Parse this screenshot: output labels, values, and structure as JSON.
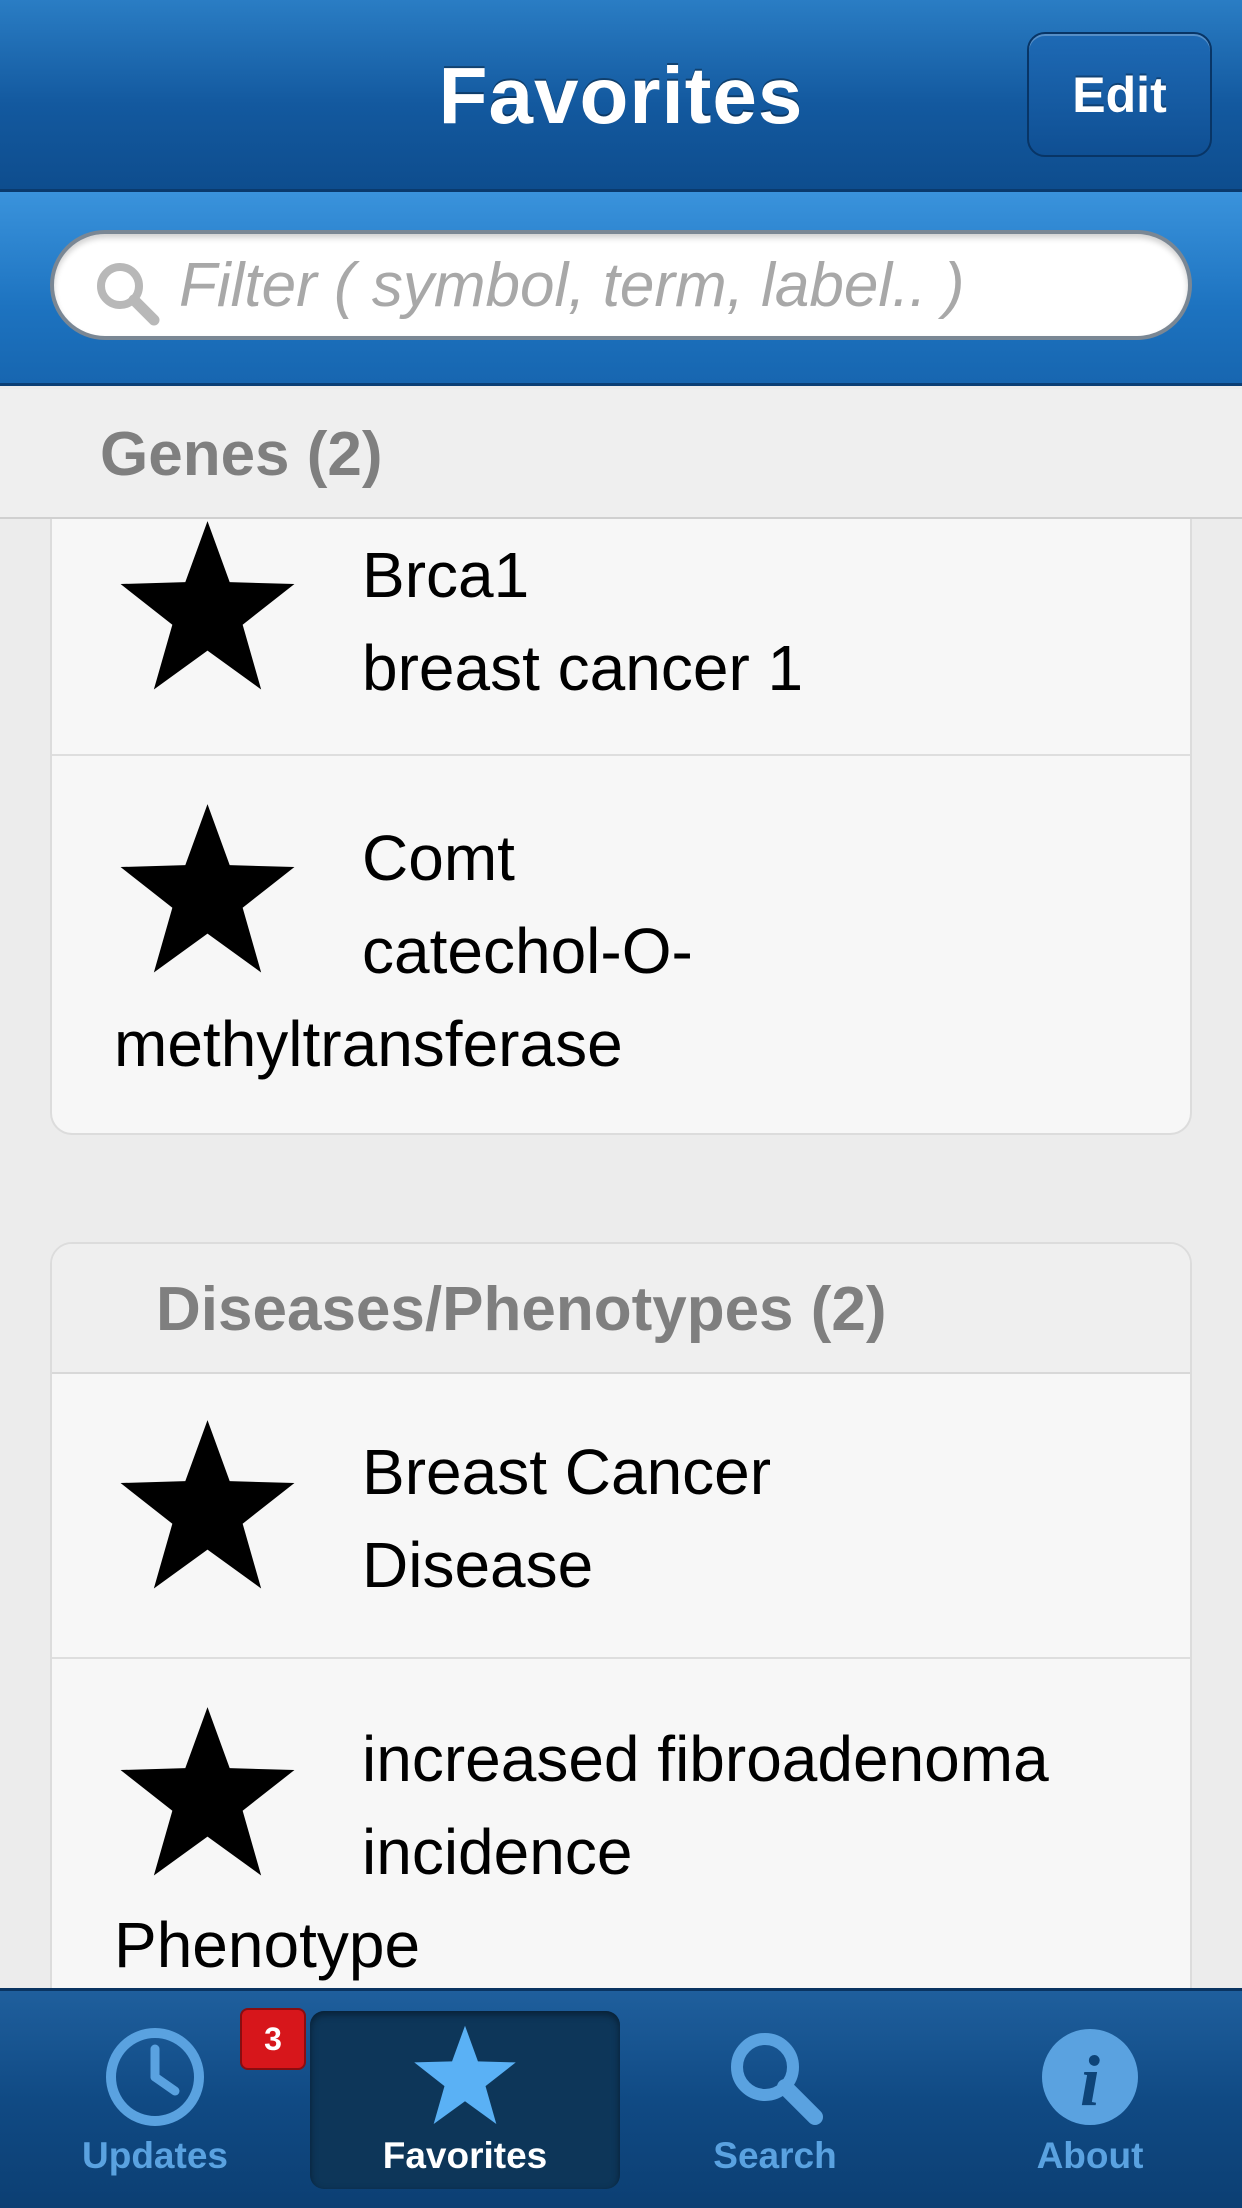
{
  "header": {
    "title": "Favorites",
    "edit_label": "Edit"
  },
  "filter": {
    "placeholder": "Filter ( symbol, term, label.. )"
  },
  "sections": [
    {
      "title": "Genes (2)",
      "items": [
        {
          "line1": "Brca1",
          "line2": "breast cancer 1",
          "line3": ""
        },
        {
          "line1": "Comt",
          "line2": "catechol-O-",
          "line3": "methyltransferase"
        }
      ]
    },
    {
      "title": "Diseases/Phenotypes (2)",
      "items": [
        {
          "line1": "Breast Cancer",
          "line2": "Disease",
          "line3": ""
        },
        {
          "line1": "increased fibroadenoma",
          "line2": "incidence",
          "line3": "Phenotype"
        }
      ]
    }
  ],
  "tabbar": {
    "tabs": [
      {
        "label": "Updates",
        "icon": "clock-icon"
      },
      {
        "label": "Favorites",
        "icon": "star-icon",
        "active": true
      },
      {
        "label": "Search",
        "icon": "search-icon"
      },
      {
        "label": "About",
        "icon": "info-icon"
      }
    ],
    "badge": "3"
  },
  "colors": {
    "header_blue": "#13599f",
    "tab_inactive": "#5aa2e0",
    "badge_red": "#d7161b"
  }
}
